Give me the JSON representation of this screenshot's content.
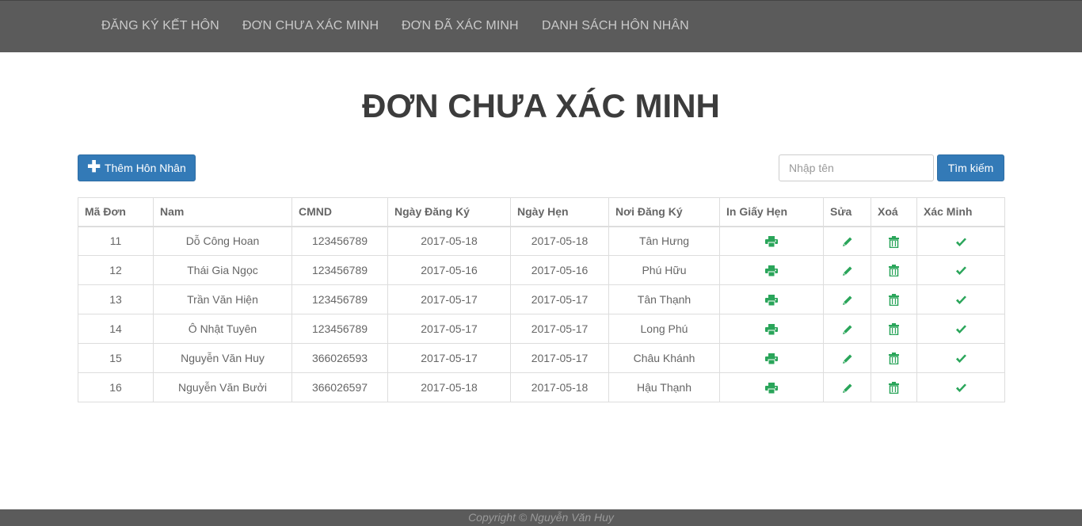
{
  "nav": {
    "items": [
      {
        "label": "ĐĂNG KÝ KẾT HÔN"
      },
      {
        "label": "ĐƠN CHƯA XÁC MINH"
      },
      {
        "label": "ĐƠN ĐÃ XÁC MINH"
      },
      {
        "label": "DANH SÁCH HÔN NHÂN"
      }
    ]
  },
  "page": {
    "title": "ĐƠN CHƯA XÁC MINH"
  },
  "toolbar": {
    "add_label": "Thêm Hôn Nhân",
    "search_placeholder": "Nhập tên",
    "search_value": "",
    "search_label": "Tìm kiếm"
  },
  "table": {
    "headers": [
      "Mã Đơn",
      "Nam",
      "CMND",
      "Ngày Đăng Ký",
      "Ngày Hẹn",
      "Nơi Đăng Ký",
      "In Giấy Hẹn",
      "Sửa",
      "Xoá",
      "Xác Minh"
    ],
    "rows": [
      {
        "id": "11",
        "name": "Dỗ Công Hoan",
        "cmnd": "123456789",
        "reg_date": "2017-05-18",
        "appt_date": "2017-05-18",
        "place": "Tân Hưng"
      },
      {
        "id": "12",
        "name": "Thái Gia Ngọc",
        "cmnd": "123456789",
        "reg_date": "2017-05-16",
        "appt_date": "2017-05-16",
        "place": "Phú Hữu"
      },
      {
        "id": "13",
        "name": "Trần Văn Hiện",
        "cmnd": "123456789",
        "reg_date": "2017-05-17",
        "appt_date": "2017-05-17",
        "place": "Tân Thạnh"
      },
      {
        "id": "14",
        "name": "Ô Nhật Tuyên",
        "cmnd": "123456789",
        "reg_date": "2017-05-17",
        "appt_date": "2017-05-17",
        "place": "Long Phú"
      },
      {
        "id": "15",
        "name": "Nguyễn Văn Huy",
        "cmnd": "366026593",
        "reg_date": "2017-05-17",
        "appt_date": "2017-05-17",
        "place": "Châu Khánh"
      },
      {
        "id": "16",
        "name": "Nguyễn Văn Bưởi",
        "cmnd": "366026597",
        "reg_date": "2017-05-18",
        "appt_date": "2017-05-18",
        "place": "Hậu Thạnh"
      }
    ]
  },
  "icons": {
    "print": "print-icon",
    "edit": "pencil-icon",
    "delete": "trash-icon",
    "verify": "check-icon",
    "add": "plus-icon"
  },
  "colors": {
    "navbar": "#5b5b5b",
    "nav_text": "#c9c9c9",
    "primary": "#337ab7",
    "icon_green": "#2aa55a",
    "title": "#3c3c3c"
  },
  "footer": {
    "text": "Copyright © Nguyễn Văn Huy"
  }
}
